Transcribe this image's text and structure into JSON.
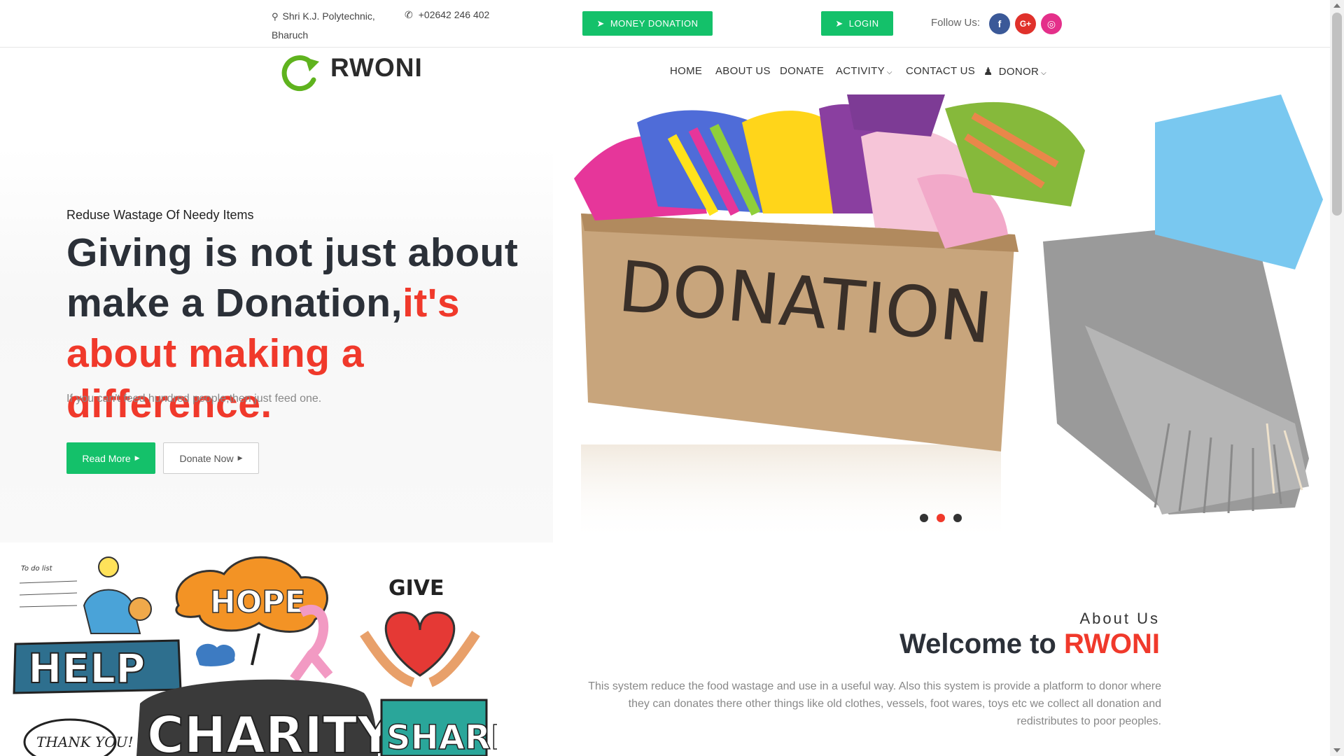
{
  "topbar": {
    "address_line1": "Shri K.J. Polytechnic,",
    "address_line2": "Bharuch",
    "phone": "+02642 246 402",
    "money_donation_label": "MONEY DONATION",
    "login_label": "LOGIN",
    "follow_label": "Follow Us:",
    "social": [
      {
        "icon": "facebook-icon",
        "glyph": "f",
        "color": "#3b5998"
      },
      {
        "icon": "google-plus-icon",
        "glyph": "G+",
        "color": "#e0312b"
      },
      {
        "icon": "instagram-icon",
        "glyph": "◎",
        "color": "#e4308a"
      }
    ]
  },
  "logo": {
    "text": "RWONI",
    "color": "#5fb31e"
  },
  "nav": {
    "items": [
      {
        "label": "HOME"
      },
      {
        "label": "ABOUT US"
      },
      {
        "label": "DONATE"
      },
      {
        "label": "ACTIVITY",
        "dropdown": true
      },
      {
        "label": "CONTACT US"
      },
      {
        "label": "DONOR",
        "dropdown": true,
        "icon": "user-icon"
      }
    ]
  },
  "hero": {
    "tagline": "Reduse Wastage Of Needy Items",
    "title_dark": "Giving is not just about make a Donation,",
    "title_red": "it's about making a difference.",
    "subtitle": "If you can't feed hundred people,then just feed one.",
    "read_more_label": "Read More",
    "donate_now_label": "Donate Now",
    "box_text": "DONATION",
    "slider_active": 2,
    "slider_count": 3
  },
  "charity_image_words": {
    "todo": "To do list",
    "hope": "HOPE",
    "give": "GIVE",
    "help": "HELP",
    "charity": "CHARITY",
    "share": "SHARE",
    "thanks": "THANK YOU!"
  },
  "about": {
    "subheading": "About Us",
    "title_dark": "Welcome to ",
    "title_red": "RWONI",
    "text": "This system reduce the food wastage and use in a useful way. Also this system is provide a platform to donor where they can donates there other things like old clothes, vessels, foot wares, toys etc we collect all donation and redistributes to poor peoples."
  },
  "colors": {
    "accent_green": "#14c16a",
    "accent_red": "#f0392b",
    "heading_dark": "#2b3038"
  }
}
